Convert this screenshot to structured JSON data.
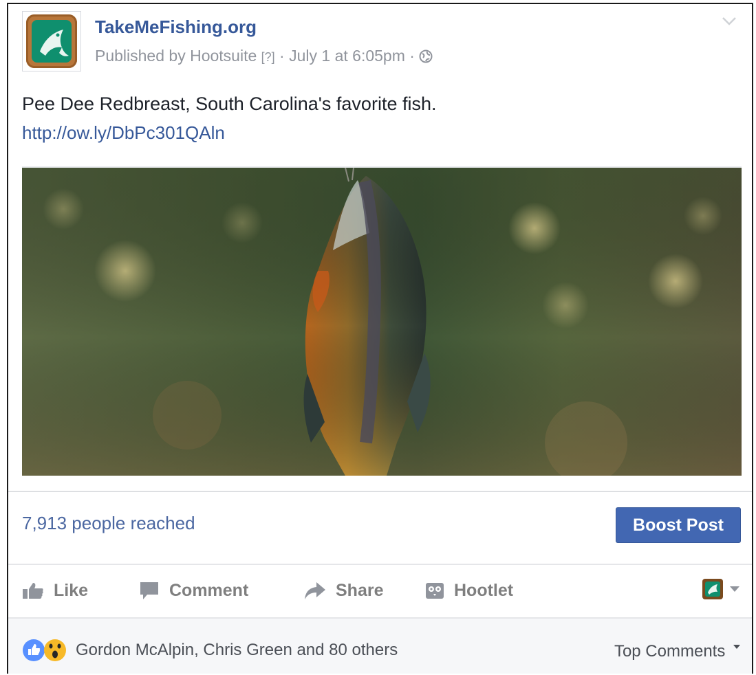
{
  "post": {
    "page_name": "TakeMeFishing.org",
    "published_prefix": "Published by ",
    "publisher": "Hootsuite",
    "help_marker": "[?]",
    "separator": " · ",
    "date": "July 1 at 6:05pm",
    "visibility_icon": "globe-icon",
    "text": "Pee Dee Redbreast, South Carolina's favorite fish.",
    "link": "http://ow.ly/DbPc301QAln",
    "photo_subject": "fish-photo"
  },
  "stats": {
    "reach": "7,913 people reached",
    "boost_label": "Boost Post"
  },
  "actions": {
    "like": "Like",
    "comment": "Comment",
    "share": "Share",
    "hootlet": "Hootlet"
  },
  "reactions": {
    "icons": [
      "like-reaction-icon",
      "wow-reaction-icon"
    ],
    "names": "Gordon McAlpin, Chris Green and 80 others",
    "sort_label": "Top Comments"
  },
  "colors": {
    "brand_blue": "#365899",
    "button_blue": "#4267b2",
    "meta_gray": "#90949c",
    "action_gray": "#7f7f7f"
  }
}
